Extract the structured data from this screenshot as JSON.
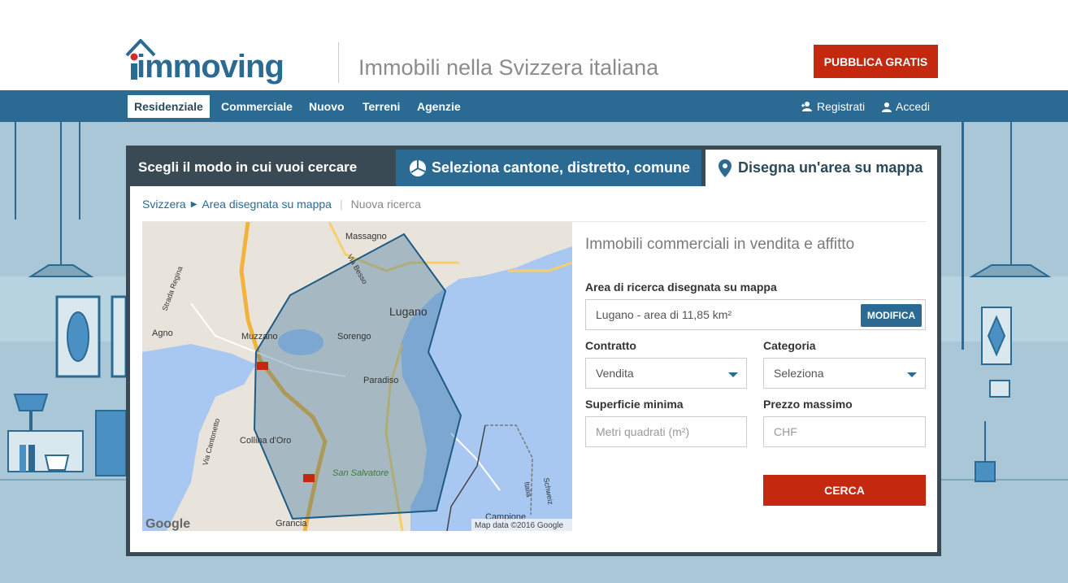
{
  "header": {
    "logo_text": "immoving",
    "tagline": "Immobili nella Svizzera italiana",
    "publish_button": "PUBBLICA GRATIS"
  },
  "nav": {
    "items": [
      "Residenziale",
      "Commerciale",
      "Nuovo",
      "Terreni",
      "Agenzie"
    ],
    "register": "Registrati",
    "login": "Accedi"
  },
  "search_panel": {
    "choose_label": "Scegli il modo in cui vuoi cercare",
    "tab_select": "Seleziona cantone, distretto, comune",
    "tab_draw": "Disegna un'area su mappa"
  },
  "breadcrumb": {
    "items": [
      "Svizzera",
      "Area disegnata su mappa"
    ],
    "new_search": "Nuova ricerca"
  },
  "map": {
    "labels": [
      "Massagno",
      "Lugano",
      "Agno",
      "Muzzano",
      "Sorengo",
      "Paradiso",
      "Collina d'Oro",
      "San Salvatore",
      "Grancia",
      "Campione",
      "Strada Regina",
      "Via Cantonetto",
      "Via Besso",
      "Schweiz",
      "Italia"
    ],
    "google": "Google",
    "attribution": "Map data ©2016 Google"
  },
  "form": {
    "title": "Immobili commerciali in vendita e affitto",
    "area_label": "Area di ricerca disegnata su mappa",
    "area_value": "Lugano - area di 11,85 km²",
    "modify_button": "MODIFICA",
    "contract_label": "Contratto",
    "contract_value": "Vendita",
    "category_label": "Categoria",
    "category_value": "Seleziona",
    "min_surface_label": "Superficie minima",
    "min_surface_placeholder": "Metri quadrati (m²)",
    "max_price_label": "Prezzo massimo",
    "max_price_placeholder": "CHF",
    "search_button": "CERCA"
  },
  "colors": {
    "brand_blue": "#2a6a93",
    "brand_red": "#c4280f",
    "panel_dark": "#3a4a54",
    "background": "#a9c7d6"
  }
}
